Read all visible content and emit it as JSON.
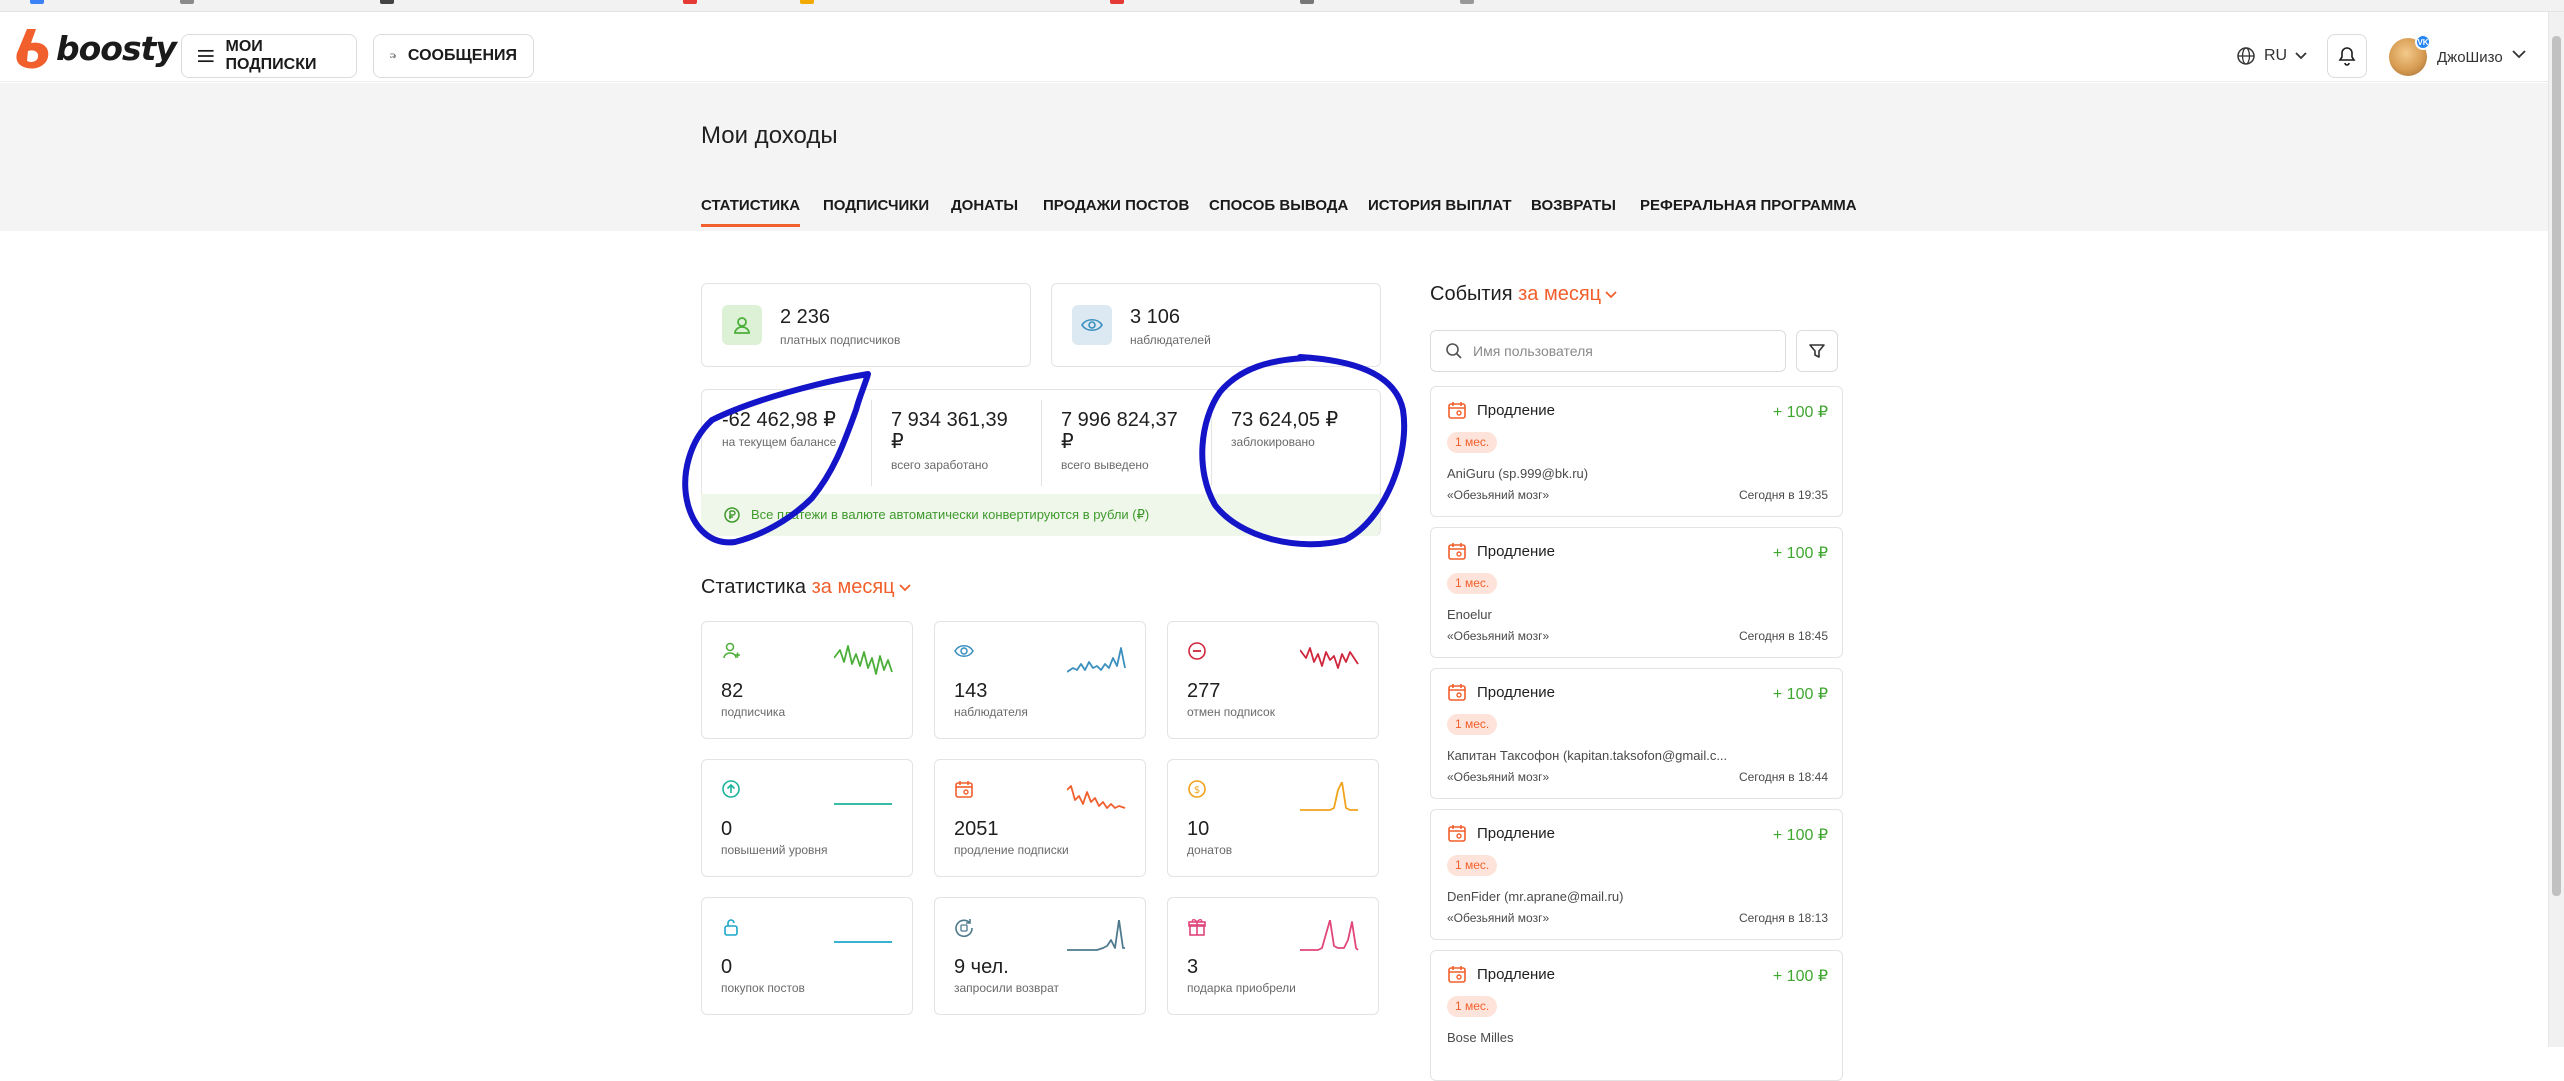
{
  "header": {
    "logo_text": "boosty",
    "subscriptions_button": "МОИ ПОДПИСКИ",
    "messages_button": "СООБЩЕНИЯ",
    "language": "RU",
    "username": "ДжоШизо",
    "avatar_badge": "VK"
  },
  "page": {
    "title": "Мои доходы",
    "tabs": [
      {
        "label": "СТАТИСТИКА"
      },
      {
        "label": "ПОДПИСЧИКИ"
      },
      {
        "label": "ДОНАТЫ"
      },
      {
        "label": "ПРОДАЖИ ПОСТОВ"
      },
      {
        "label": "СПОСОБ ВЫВОДА"
      },
      {
        "label": "ИСТОРИЯ ВЫПЛАТ"
      },
      {
        "label": "ВОЗВРАТЫ"
      },
      {
        "label": "РЕФЕРАЛЬНАЯ ПРОГРАММА"
      }
    ]
  },
  "summary": {
    "paid_subscribers": {
      "value": "2 236",
      "label": "платных подписчиков"
    },
    "followers": {
      "value": "3 106",
      "label": "наблюдателей"
    }
  },
  "balance": [
    {
      "value": "-62 462,98 ₽",
      "label": "на текущем балансе"
    },
    {
      "value_line1": "7 934 361,39",
      "value_line2": "₽",
      "label": "всего заработано"
    },
    {
      "value_line1": "7 996 824,37",
      "value_line2": "₽",
      "label": "всего выведено"
    },
    {
      "value": "73 624,05 ₽",
      "label": "заблокировано"
    }
  ],
  "currency_note": "Все платежи в валюте автоматически конвертируются в рубли (₽)",
  "stats": {
    "title": "Статистика",
    "period": "за месяц",
    "cards": [
      {
        "value": "82",
        "label": "подписчика",
        "color": "#4caf3a",
        "icon": "user-plus-icon"
      },
      {
        "value": "143",
        "label": "наблюдателя",
        "color": "#3a8fbf",
        "icon": "eye-icon"
      },
      {
        "value": "277",
        "label": "отмен подписок",
        "color": "#d0263c",
        "icon": "minus-circle-icon"
      },
      {
        "value": "0",
        "label": "повышений уровня",
        "color": "#1bb39b",
        "icon": "arrow-up-circle-icon"
      },
      {
        "value": "2051",
        "label": "продление подписки",
        "color": "#f15f2c",
        "icon": "calendar-icon"
      },
      {
        "value": "10",
        "label": "донатов",
        "color": "#f0a21c",
        "icon": "coin-icon"
      },
      {
        "value": "0",
        "label": "покупок постов",
        "color": "#1ba7c9",
        "icon": "lock-icon"
      },
      {
        "value": "9 чел.",
        "label": "запросили возврат",
        "color": "#4f7a8e",
        "icon": "refund-icon"
      },
      {
        "value": "3",
        "label": "подарка приобрели",
        "color": "#e0457b",
        "icon": "gift-icon"
      }
    ]
  },
  "events": {
    "title": "События",
    "period": "за месяц",
    "search_placeholder": "Имя пользователя",
    "items": [
      {
        "type": "Продление",
        "amount": "+ 100 ₽",
        "duration": "1 мес.",
        "user": "AniGuru (sp.999@bk.ru)",
        "subscription": "«Обезьяний мозг»",
        "time": "Сегодня в 19:35"
      },
      {
        "type": "Продление",
        "amount": "+ 100 ₽",
        "duration": "1 мес.",
        "user": "Enoelur",
        "subscription": "«Обезьяний мозг»",
        "time": "Сегодня в 18:45"
      },
      {
        "type": "Продление",
        "amount": "+ 100 ₽",
        "duration": "1 мес.",
        "user": "Капитан Таксофон (kapitan.taksofon@gmail.c...",
        "subscription": "«Обезьяний мозг»",
        "time": "Сегодня в 18:44"
      },
      {
        "type": "Продление",
        "amount": "+ 100 ₽",
        "duration": "1 мес.",
        "user": "DenFider (mr.aprane@mail.ru)",
        "subscription": "«Обезьяний мозг»",
        "time": "Сегодня в 18:13"
      },
      {
        "type": "Продление",
        "amount": "+ 100 ₽",
        "duration": "1 мес.",
        "user": "Bose Milles",
        "subscription": "",
        "time": ""
      }
    ]
  },
  "colors": {
    "accent": "#f15f2c",
    "positive": "#3fa62f",
    "annotation": "#1414c8"
  }
}
